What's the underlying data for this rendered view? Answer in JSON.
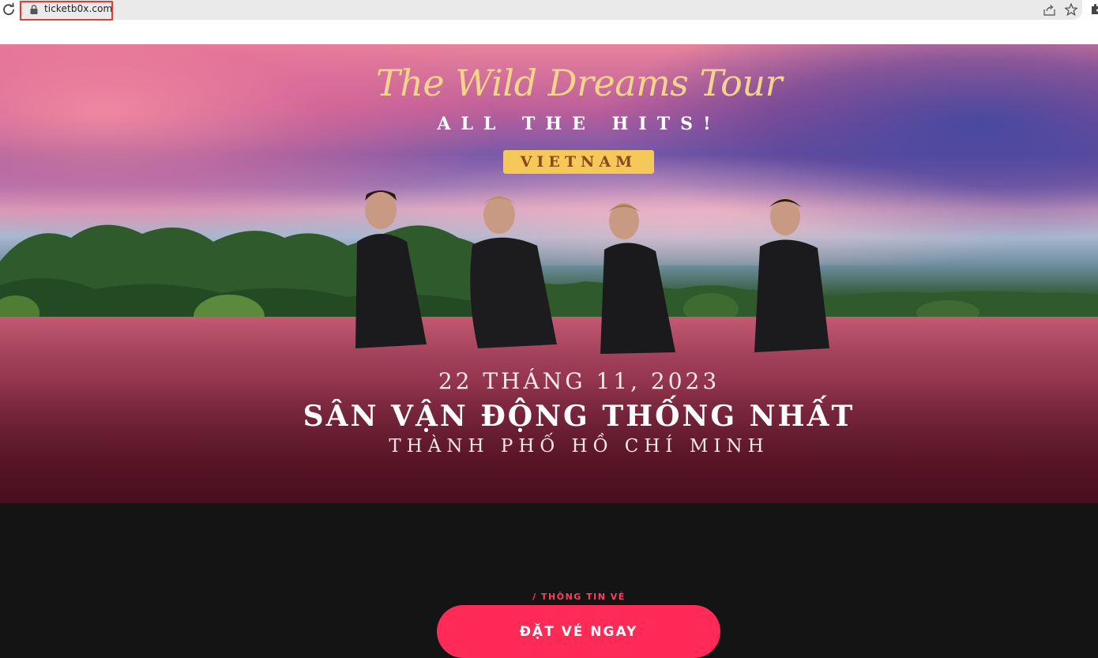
{
  "browser": {
    "url": "ticketb0x.com",
    "icons": [
      "reload-icon",
      "lock-icon",
      "share-icon",
      "star-icon",
      "extensions-icon"
    ]
  },
  "hero": {
    "tour_title": "The Wild Dreams Tour",
    "subtitle": "ALL THE HITS!",
    "country": "VIETNAM",
    "date": "22 THÁNG 11, 2023",
    "venue": "SÂN VẬN ĐỘNG THỐNG NHẤT",
    "city": "THÀNH PHỐ HỒ CHÍ MINH"
  },
  "tickets": {
    "section_label": "/ THÔNG TIN VÉ",
    "buy_button": "ĐẶT VÉ NGAY"
  },
  "colors": {
    "accent": "#ff2a55",
    "title_gold": "#f2d48a",
    "badge": "#f5c85a",
    "url_highlight": "#e53935",
    "dark_bg": "#141414"
  }
}
